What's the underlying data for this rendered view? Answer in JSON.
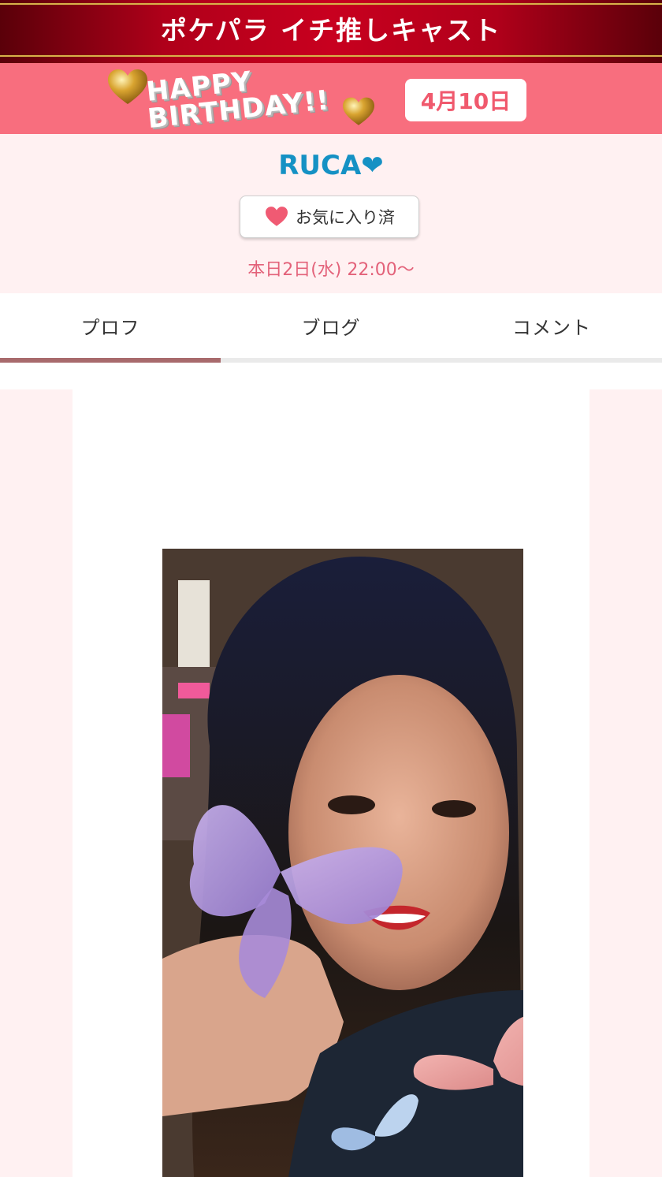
{
  "header": {
    "title": "ポケパラ イチ推しキャスト"
  },
  "birthday": {
    "line1": "HAPPY",
    "line2": "BIRTHDAY!!",
    "date": "4月10日"
  },
  "profile": {
    "name": "RUCA❤",
    "favorite_label": "お気に入り済",
    "schedule": "本日2日(水) 22:00〜"
  },
  "tabs": [
    {
      "label": "プロフ",
      "active": true
    },
    {
      "label": "ブログ",
      "active": false
    },
    {
      "label": "コメント",
      "active": false
    }
  ],
  "colors": {
    "header_red": "#c8001f",
    "banner_pink": "#f86e7e",
    "name_blue": "#1591c4",
    "schedule_pink": "#e3627a",
    "tab_active": "#a86a6c",
    "bg_pink": "#fff1f2"
  },
  "icons": [
    "heart-icon",
    "gold-heart-icon"
  ]
}
